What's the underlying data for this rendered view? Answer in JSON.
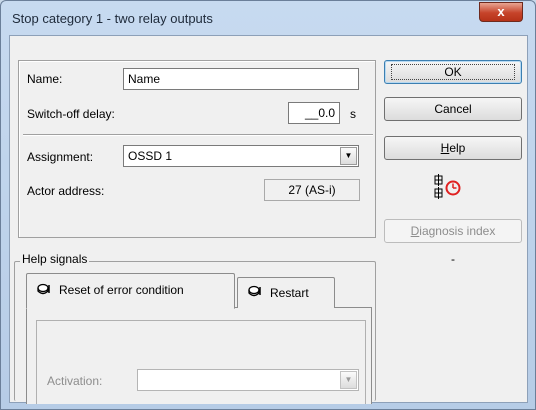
{
  "window": {
    "title": "Stop category 1 - two relay outputs",
    "close_glyph": "x"
  },
  "form": {
    "name_label": "Name:",
    "name_value": "Name",
    "delay_label": "Switch-off delay:",
    "delay_value": "__0.0",
    "delay_unit": "s",
    "assignment_label": "Assignment:",
    "assignment_value": "OSSD 1",
    "actor_label": "Actor address:",
    "actor_value": "27 (AS-i)"
  },
  "buttons": {
    "ok": "OK",
    "cancel": "Cancel",
    "help_first": "H",
    "help_rest": "elp",
    "diagnosis_first": "D",
    "diagnosis_rest": "iagnosis index",
    "dash": "-"
  },
  "help_signals": {
    "title": "Help signals",
    "tabs": [
      {
        "label": "Reset of error condition",
        "icon": "pushbutton-icon"
      },
      {
        "label": "Restart",
        "icon": "pushbutton-icon"
      }
    ],
    "activation_label": "Activation:",
    "activation_value": ""
  },
  "icons": {
    "timer": "relay-timer-icon"
  },
  "colors": {
    "close_button": "#c6432a",
    "timer_red": "#e02020",
    "disabled_text": "#8d8d8d"
  }
}
